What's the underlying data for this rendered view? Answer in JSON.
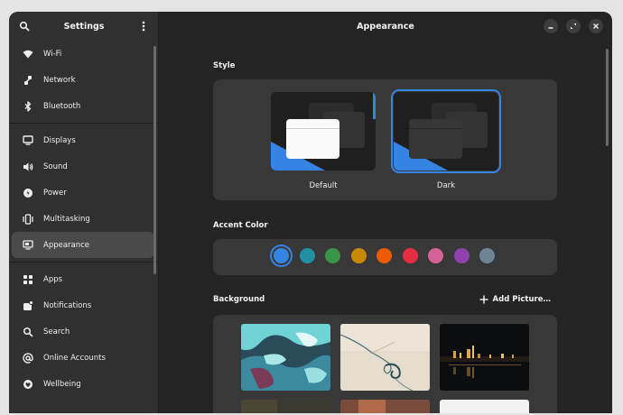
{
  "sidebar": {
    "title": "Settings",
    "items_group1": [
      {
        "label": "Wi-Fi",
        "icon": "wifi-icon"
      },
      {
        "label": "Network",
        "icon": "network-icon"
      },
      {
        "label": "Bluetooth",
        "icon": "bluetooth-icon"
      }
    ],
    "items_group2": [
      {
        "label": "Displays",
        "icon": "display-icon"
      },
      {
        "label": "Sound",
        "icon": "speaker-icon"
      },
      {
        "label": "Power",
        "icon": "power-icon"
      },
      {
        "label": "Multitasking",
        "icon": "multitasking-icon"
      },
      {
        "label": "Appearance",
        "icon": "appearance-icon"
      }
    ],
    "items_group3": [
      {
        "label": "Apps",
        "icon": "apps-grid-icon"
      },
      {
        "label": "Notifications",
        "icon": "notifications-icon"
      },
      {
        "label": "Search",
        "icon": "search-icon"
      },
      {
        "label": "Online Accounts",
        "icon": "at-icon"
      },
      {
        "label": "Wellbeing",
        "icon": "wellbeing-icon"
      }
    ],
    "active": "Appearance"
  },
  "main": {
    "title": "Appearance",
    "style": {
      "label": "Style",
      "options": [
        {
          "label": "Default"
        },
        {
          "label": "Dark",
          "selected": true
        }
      ]
    },
    "accent": {
      "label": "Accent Color",
      "colors": [
        "#3584e4",
        "#2190a4",
        "#3a944a",
        "#c88800",
        "#ed5b00",
        "#e62d42",
        "#d56199",
        "#9141ac",
        "#6f8396"
      ],
      "selected_index": 0
    },
    "background": {
      "label": "Background",
      "add_label": "Add Picture…"
    }
  },
  "colors": {
    "accent": "#3584e4",
    "window_bg": "#242424",
    "sidebar_bg": "#303030",
    "card_bg": "#383838"
  }
}
